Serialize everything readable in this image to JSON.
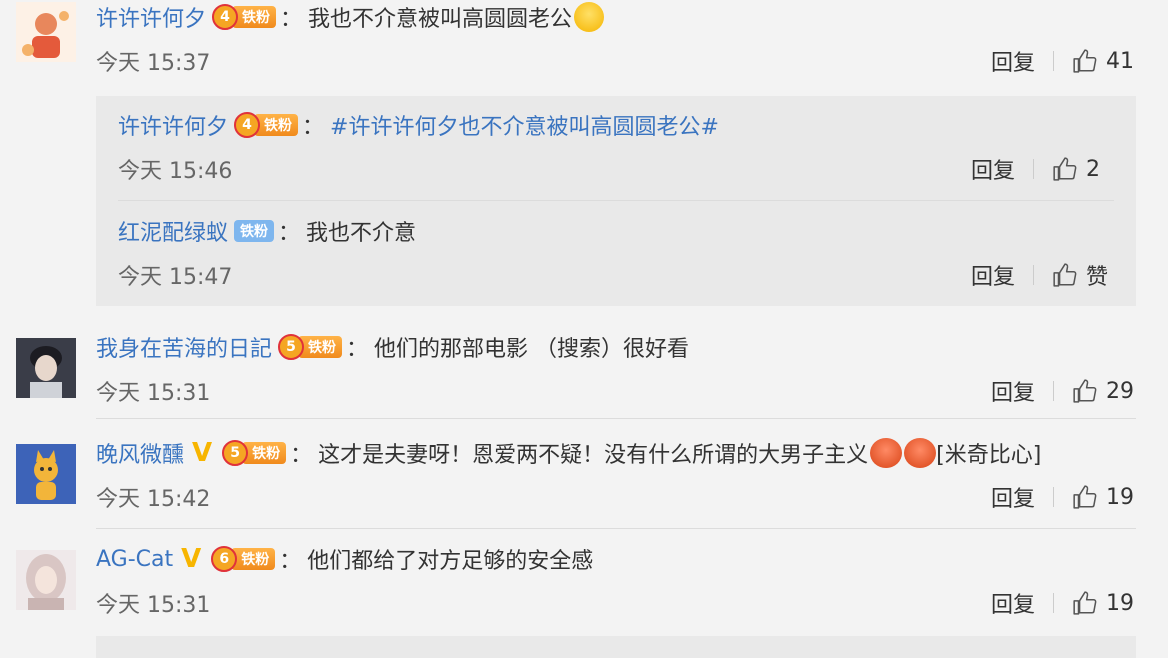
{
  "ui": {
    "reply_label": "回复",
    "like_icon": "thumbs-up-icon"
  },
  "comments": [
    {
      "username": "许许许何夕",
      "badge_level": "4",
      "badge_text": "铁粉",
      "text": "我也不介意被叫高圆圆老公",
      "time": "今天 15:37",
      "likes": "41",
      "replies": [
        {
          "username": "许许许何夕",
          "badge_level": "4",
          "badge_text": "铁粉",
          "text": "#许许许何夕也不介意被叫高圆圆老公#",
          "time": "今天 15:46",
          "likes": "2"
        },
        {
          "username": "红泥配绿蚁",
          "badge_text": "铁粉",
          "text": "我也不介意",
          "time": "今天 15:47",
          "likes": "赞"
        }
      ]
    },
    {
      "username": "我身在苦海的日記",
      "badge_level": "5",
      "badge_text": "铁粉",
      "text": "他们的那部电影 （搜索）很好看",
      "time": "今天 15:31",
      "likes": "29"
    },
    {
      "username": "晚风微醺",
      "verified": "V",
      "badge_level": "5",
      "badge_text": "铁粉",
      "text": "这才是夫妻呀！恩爱两不疑！没有什么所谓的大男子主义",
      "text_suffix": "[米奇比心]",
      "time": "今天 15:42",
      "likes": "19"
    },
    {
      "username": "AG-Cat",
      "verified": "V",
      "badge_level": "6",
      "badge_text": "铁粉",
      "text": "他们都给了对方足够的安全感",
      "time": "今天 15:31",
      "likes": "19"
    }
  ]
}
